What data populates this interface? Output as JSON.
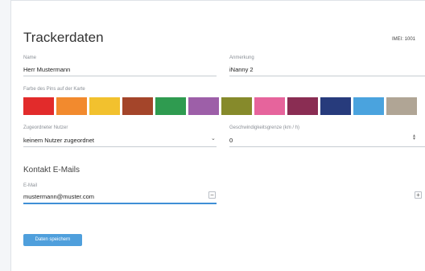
{
  "title": "Trackerdaten",
  "imei": "IMEI: 1001",
  "name": {
    "label": "Name",
    "value": "Herr Mustermann"
  },
  "note": {
    "label": "Anmerkung",
    "value": "iNanny 2"
  },
  "pin_color": {
    "label": "Farbe des Pins auf der Karte",
    "swatches": [
      "#e22b2b",
      "#f28a2e",
      "#f2c12e",
      "#a4452a",
      "#2f9b50",
      "#9d5fa8",
      "#868a2b",
      "#e6649c",
      "#8a2d53",
      "#273b7c",
      "#4aa3de",
      "#b0a595"
    ]
  },
  "user": {
    "label": "Zugeordneter Nutzer",
    "value": "keinem Nutzer zugeordnet",
    "arrow": "⌄"
  },
  "speed": {
    "label": "Geschwindigkeitsgrenze (km / h)",
    "value": "0"
  },
  "contacts": {
    "title": "Kontakt E-Mails",
    "email_label": "E-Mail",
    "email_value": "mustermann@muster.com",
    "remove": "−",
    "add": "+"
  },
  "save_label": "Daten speichern"
}
